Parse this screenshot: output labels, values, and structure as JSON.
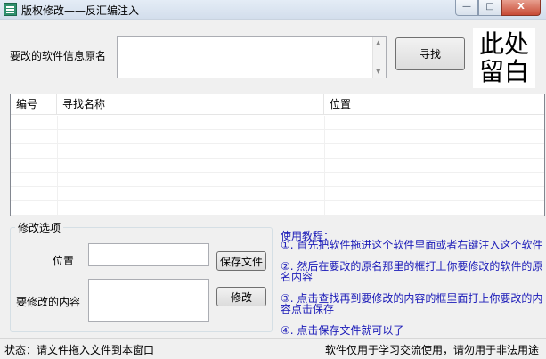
{
  "window": {
    "title": "版权修改——反汇编注入",
    "minimize_glyph": "—",
    "maximize_glyph": "□",
    "close_glyph": "X",
    "icon": "app-icon"
  },
  "search": {
    "label": "要改的软件信息原名",
    "value": "",
    "find_button": "寻找"
  },
  "placeholder": {
    "line1": "此处",
    "line2": "留白"
  },
  "list": {
    "columns": [
      "编号",
      "寻找名称",
      "位置"
    ],
    "rows": []
  },
  "modify_options": {
    "title": "修改选项",
    "position_label": "位置",
    "position_value": "",
    "save_button": "保存文件",
    "content_label": "要修改的内容",
    "content_value": "",
    "modify_button": "修改"
  },
  "tutorial": {
    "title": "使用教程：",
    "steps": [
      "①. 首先把软件拖进这个软件里面或者右键注入这个软件",
      "②. 然后在要改的原名那里的框打上你要修改的软件的原名内容",
      "③. 点击查找再到要修改的内容的框里面打上你要改的内容点击保存",
      "④. 点击保存文件就可以了"
    ]
  },
  "status": {
    "left": "状态：请文件拖入文件到本窗口",
    "right": "软件仅用于学习交流使用，请勿用于非法用途"
  }
}
